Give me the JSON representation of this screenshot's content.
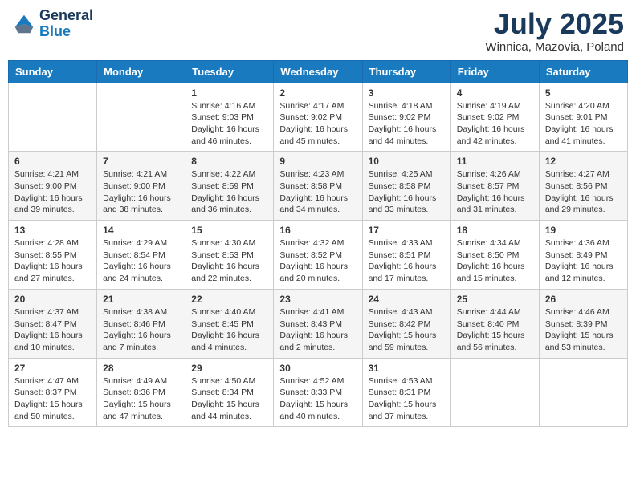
{
  "header": {
    "logo_line1": "General",
    "logo_line2": "Blue",
    "title": "July 2025",
    "subtitle": "Winnica, Mazovia, Poland"
  },
  "weekdays": [
    "Sunday",
    "Monday",
    "Tuesday",
    "Wednesday",
    "Thursday",
    "Friday",
    "Saturday"
  ],
  "weeks": [
    [
      {
        "day": "",
        "info": ""
      },
      {
        "day": "",
        "info": ""
      },
      {
        "day": "1",
        "info": "Sunrise: 4:16 AM\nSunset: 9:03 PM\nDaylight: 16 hours and 46 minutes."
      },
      {
        "day": "2",
        "info": "Sunrise: 4:17 AM\nSunset: 9:02 PM\nDaylight: 16 hours and 45 minutes."
      },
      {
        "day": "3",
        "info": "Sunrise: 4:18 AM\nSunset: 9:02 PM\nDaylight: 16 hours and 44 minutes."
      },
      {
        "day": "4",
        "info": "Sunrise: 4:19 AM\nSunset: 9:02 PM\nDaylight: 16 hours and 42 minutes."
      },
      {
        "day": "5",
        "info": "Sunrise: 4:20 AM\nSunset: 9:01 PM\nDaylight: 16 hours and 41 minutes."
      }
    ],
    [
      {
        "day": "6",
        "info": "Sunrise: 4:21 AM\nSunset: 9:00 PM\nDaylight: 16 hours and 39 minutes."
      },
      {
        "day": "7",
        "info": "Sunrise: 4:21 AM\nSunset: 9:00 PM\nDaylight: 16 hours and 38 minutes."
      },
      {
        "day": "8",
        "info": "Sunrise: 4:22 AM\nSunset: 8:59 PM\nDaylight: 16 hours and 36 minutes."
      },
      {
        "day": "9",
        "info": "Sunrise: 4:23 AM\nSunset: 8:58 PM\nDaylight: 16 hours and 34 minutes."
      },
      {
        "day": "10",
        "info": "Sunrise: 4:25 AM\nSunset: 8:58 PM\nDaylight: 16 hours and 33 minutes."
      },
      {
        "day": "11",
        "info": "Sunrise: 4:26 AM\nSunset: 8:57 PM\nDaylight: 16 hours and 31 minutes."
      },
      {
        "day": "12",
        "info": "Sunrise: 4:27 AM\nSunset: 8:56 PM\nDaylight: 16 hours and 29 minutes."
      }
    ],
    [
      {
        "day": "13",
        "info": "Sunrise: 4:28 AM\nSunset: 8:55 PM\nDaylight: 16 hours and 27 minutes."
      },
      {
        "day": "14",
        "info": "Sunrise: 4:29 AM\nSunset: 8:54 PM\nDaylight: 16 hours and 24 minutes."
      },
      {
        "day": "15",
        "info": "Sunrise: 4:30 AM\nSunset: 8:53 PM\nDaylight: 16 hours and 22 minutes."
      },
      {
        "day": "16",
        "info": "Sunrise: 4:32 AM\nSunset: 8:52 PM\nDaylight: 16 hours and 20 minutes."
      },
      {
        "day": "17",
        "info": "Sunrise: 4:33 AM\nSunset: 8:51 PM\nDaylight: 16 hours and 17 minutes."
      },
      {
        "day": "18",
        "info": "Sunrise: 4:34 AM\nSunset: 8:50 PM\nDaylight: 16 hours and 15 minutes."
      },
      {
        "day": "19",
        "info": "Sunrise: 4:36 AM\nSunset: 8:49 PM\nDaylight: 16 hours and 12 minutes."
      }
    ],
    [
      {
        "day": "20",
        "info": "Sunrise: 4:37 AM\nSunset: 8:47 PM\nDaylight: 16 hours and 10 minutes."
      },
      {
        "day": "21",
        "info": "Sunrise: 4:38 AM\nSunset: 8:46 PM\nDaylight: 16 hours and 7 minutes."
      },
      {
        "day": "22",
        "info": "Sunrise: 4:40 AM\nSunset: 8:45 PM\nDaylight: 16 hours and 4 minutes."
      },
      {
        "day": "23",
        "info": "Sunrise: 4:41 AM\nSunset: 8:43 PM\nDaylight: 16 hours and 2 minutes."
      },
      {
        "day": "24",
        "info": "Sunrise: 4:43 AM\nSunset: 8:42 PM\nDaylight: 15 hours and 59 minutes."
      },
      {
        "day": "25",
        "info": "Sunrise: 4:44 AM\nSunset: 8:40 PM\nDaylight: 15 hours and 56 minutes."
      },
      {
        "day": "26",
        "info": "Sunrise: 4:46 AM\nSunset: 8:39 PM\nDaylight: 15 hours and 53 minutes."
      }
    ],
    [
      {
        "day": "27",
        "info": "Sunrise: 4:47 AM\nSunset: 8:37 PM\nDaylight: 15 hours and 50 minutes."
      },
      {
        "day": "28",
        "info": "Sunrise: 4:49 AM\nSunset: 8:36 PM\nDaylight: 15 hours and 47 minutes."
      },
      {
        "day": "29",
        "info": "Sunrise: 4:50 AM\nSunset: 8:34 PM\nDaylight: 15 hours and 44 minutes."
      },
      {
        "day": "30",
        "info": "Sunrise: 4:52 AM\nSunset: 8:33 PM\nDaylight: 15 hours and 40 minutes."
      },
      {
        "day": "31",
        "info": "Sunrise: 4:53 AM\nSunset: 8:31 PM\nDaylight: 15 hours and 37 minutes."
      },
      {
        "day": "",
        "info": ""
      },
      {
        "day": "",
        "info": ""
      }
    ]
  ]
}
